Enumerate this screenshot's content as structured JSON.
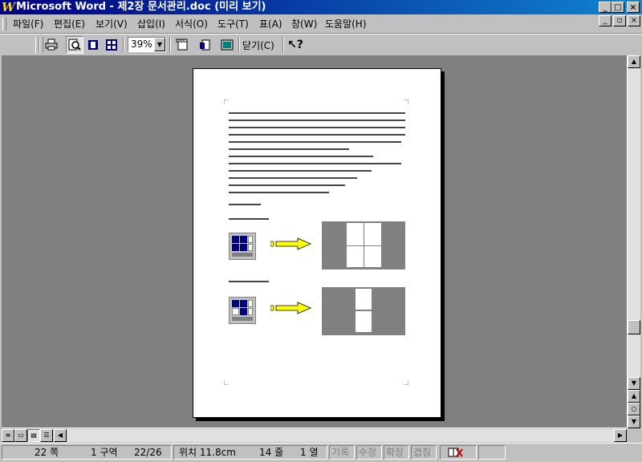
{
  "window": {
    "title": "Microsoft Word - 제2장 문서관리.doc (미리 보기)",
    "app_icon": "word-icon",
    "controls": [
      "minimize",
      "maximize",
      "close"
    ]
  },
  "menu": [
    {
      "label": "파일(F)"
    },
    {
      "label": "편집(E)"
    },
    {
      "label": "보기(V)"
    },
    {
      "label": "삽입(I)"
    },
    {
      "label": "서식(O)"
    },
    {
      "label": "도구(T)"
    },
    {
      "label": "표(A)"
    },
    {
      "label": "창(W)"
    },
    {
      "label": "도움말(H)"
    }
  ],
  "toolbar": {
    "zoom_value": "39%",
    "close_label": "닫기(C)",
    "icons": [
      "print-icon",
      "magnifier-icon",
      "one-page-icon",
      "multiple-pages-icon",
      "view-ruler-icon",
      "shrink-to-fit-icon",
      "full-screen-icon",
      "context-help-icon"
    ]
  },
  "status": {
    "page": "22 쪽",
    "section": "1 구역",
    "page_of": "22/26",
    "position": "위치 11.8cm",
    "line": "14 줄",
    "column": "1 열",
    "rec": "기록",
    "trk": "수정",
    "ext": "확장",
    "ovr": "겹침"
  },
  "colors": {
    "titlebar_start": "#000080",
    "titlebar_end": "#1084d0",
    "workspace": "#808080",
    "arrow": "#ffff00"
  }
}
